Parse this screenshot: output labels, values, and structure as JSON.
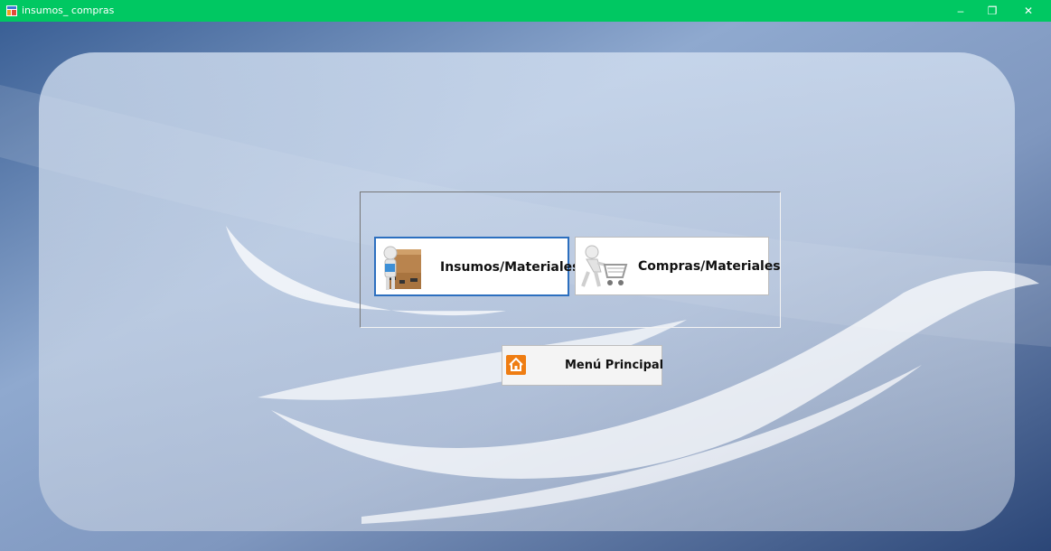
{
  "window": {
    "title": "insumos_ compras",
    "controls": {
      "minimize": "–",
      "maximize": "❐",
      "close": "✕"
    }
  },
  "buttons": {
    "insumos": {
      "label": "Insumos/Materiales",
      "icon": "person-with-boxes-icon"
    },
    "compras": {
      "label": "Compras/Materiales",
      "icon": "person-with-cart-icon"
    },
    "menu": {
      "label": "Menú Principal",
      "icon": "home-icon"
    }
  },
  "colors": {
    "titlebar": "#00c862",
    "selected_border": "#2c6fbf",
    "home_icon_bg": "#ef7d12"
  }
}
